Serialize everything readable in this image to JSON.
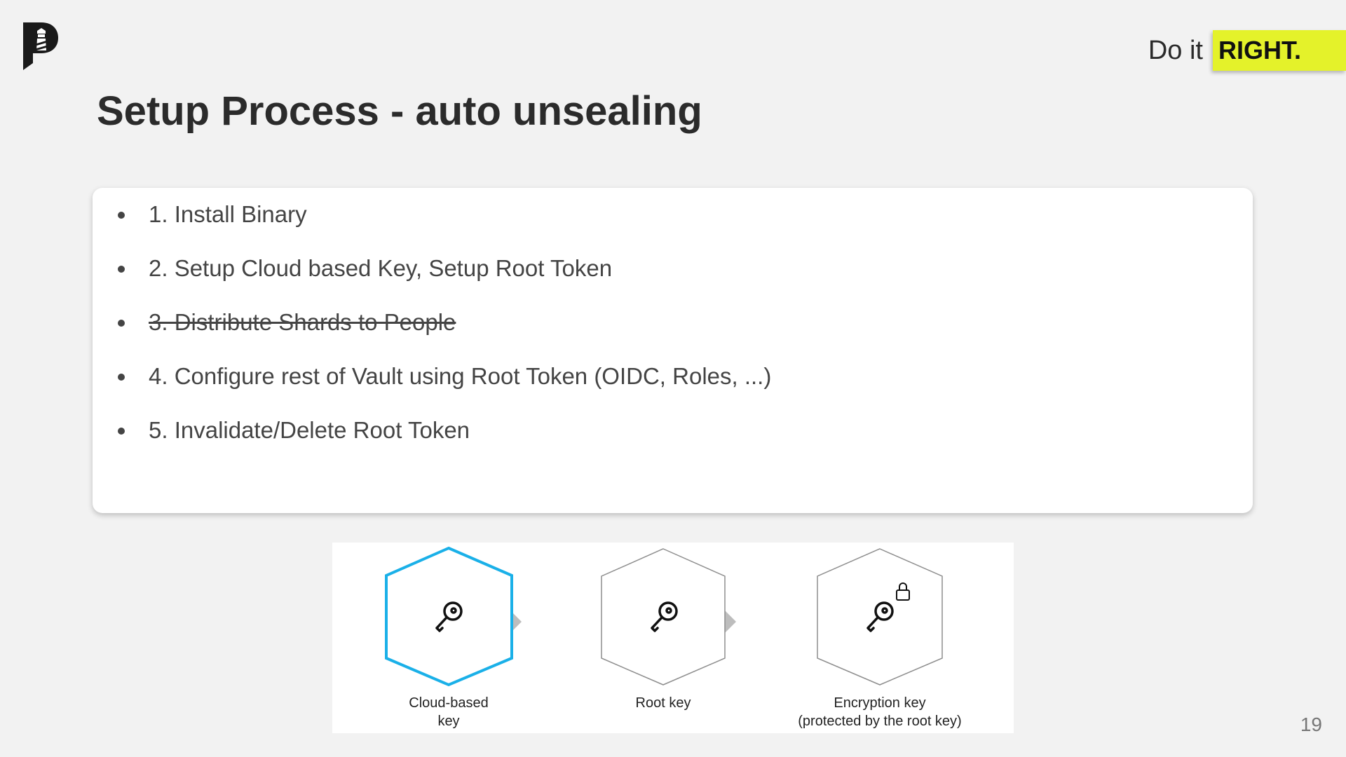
{
  "header": {
    "logo_icon": "lighthouse-p-logo",
    "tagline_plain": "Do it",
    "tagline_highlight": "RIGHT.",
    "highlight_color": "#e4f22a"
  },
  "title": "Setup Process - auto unsealing",
  "steps": [
    {
      "text": "1. Install Binary",
      "strikethrough": false
    },
    {
      "text": "2. Setup Cloud based Key, Setup Root Token",
      "strikethrough": false
    },
    {
      "text": "3. Distribute Shards to People",
      "strikethrough": true
    },
    {
      "text": "4. Configure rest of Vault using Root Token (OIDC, Roles, ...)",
      "strikethrough": false
    },
    {
      "text": "5. Invalidate/Delete Root Token",
      "strikethrough": false
    }
  ],
  "diagram": {
    "nodes": [
      {
        "label_line1": "Cloud-based",
        "label_line2": "key",
        "icon": "key-icon",
        "accent_color": "#1ab0e8"
      },
      {
        "label_line1": "Root key",
        "label_line2": "",
        "icon": "key-icon"
      },
      {
        "label_line1": "Encryption key",
        "label_line2": "(protected by the root key)",
        "icon": "locked-key-icon"
      }
    ]
  },
  "page_number": "19"
}
